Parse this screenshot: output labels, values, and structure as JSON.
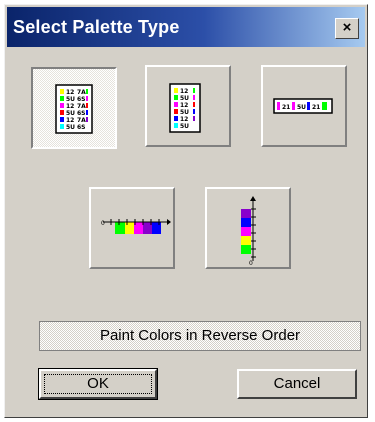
{
  "dialog": {
    "title": "Select Palette Type",
    "close_label": "×"
  },
  "palette_tiles": [
    {
      "id": "two-column-list",
      "selected": true,
      "labels": [
        "12",
        "7A",
        "5U",
        "6S",
        "12",
        "7A",
        "5U",
        "6S",
        "12",
        "7A",
        "5U",
        "6S"
      ]
    },
    {
      "id": "single-column-list",
      "selected": false
    },
    {
      "id": "horizontal-strip",
      "selected": false,
      "labels": [
        "21",
        "5U",
        "21"
      ]
    },
    {
      "id": "horizontal-colorbar",
      "selected": false,
      "axis_label": "0"
    },
    {
      "id": "vertical-colorbar",
      "selected": false,
      "axis_label": "0"
    }
  ],
  "reverse_button": {
    "label": "Paint Colors in Reverse Order"
  },
  "ok_button": {
    "label": "OK"
  },
  "cancel_button": {
    "label": "Cancel"
  },
  "colors": {
    "yellow": "#ffff00",
    "green": "#00ff00",
    "magenta": "#ff00ff",
    "blue": "#0000ff",
    "red": "#ff0000",
    "cyan": "#00ffff",
    "purple": "#8800cc",
    "title_bar": "#0a246a"
  }
}
